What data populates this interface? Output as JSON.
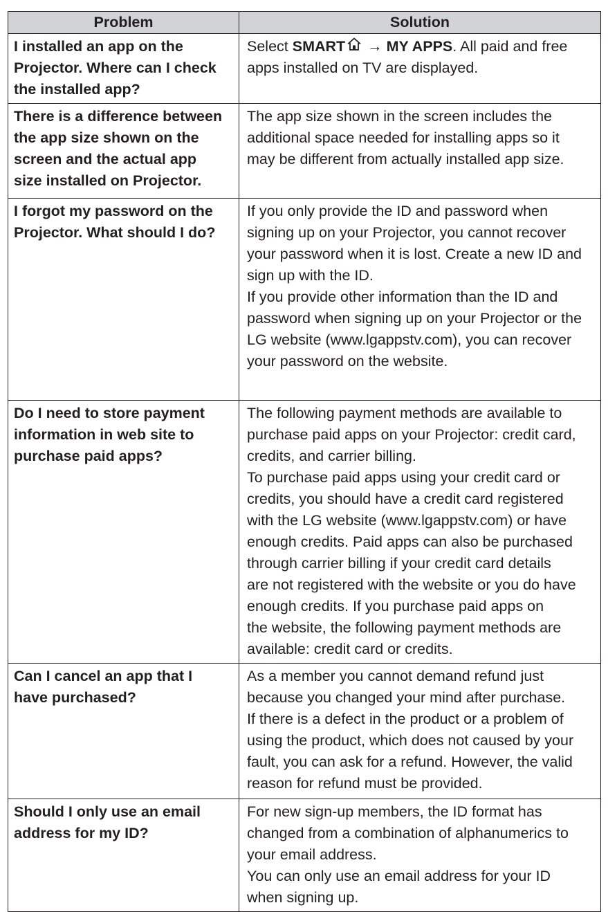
{
  "table": {
    "headers": {
      "problem": "Problem",
      "solution": "Solution"
    },
    "rows": [
      {
        "problem": [
          "I installed an app on the",
          "Projector. Where can I check",
          "the installed app?"
        ],
        "solution_intro": "Select ",
        "solution_smart": "SMART",
        "solution_arrow": " → ",
        "solution_myapps": "MY APPS",
        "solution_tail": ". All paid and free",
        "solution": [
          "apps installed on TV are displayed."
        ]
      },
      {
        "problem": [
          "There is a difference between",
          "the app size shown on the",
          "screen and the actual app",
          "size installed on Projector."
        ],
        "solution": [
          "The app size shown in the screen includes the",
          "additional space needed for installing apps so it",
          "may be different from actually installed app size."
        ]
      },
      {
        "problem": [
          "I forgot my password on the",
          "Projector. What should I do?"
        ],
        "solution": [
          "If you only provide the ID and password when",
          "signing up on your Projector, you cannot recover",
          "your password when it is lost. Create a new ID and",
          "sign up with the ID.",
          "If you provide other information than the ID and",
          "password when signing up on your Projector or the",
          "LG website (www.lgappstv.com), you can recover",
          "your password on the website."
        ]
      },
      {
        "problem": [
          "Do I need to store payment",
          "information in web site to",
          "purchase paid apps?"
        ],
        "solution": [
          "The following payment methods are available to",
          "purchase paid apps on your Projector: credit card,",
          "credits, and carrier billing.",
          "To purchase paid apps using your credit card or",
          "credits, you should have a credit card registered",
          "with the LG website (www.lgappstv.com) or have",
          "enough credits. Paid apps can also be purchased",
          "through carrier billing if your credit card details",
          "are not registered with the website or you do have",
          "enough credits. If you purchase paid apps on",
          "the website, the following payment methods are",
          "available: credit card or credits."
        ]
      },
      {
        "problem": [
          "Can I cancel an app that I",
          "have purchased?"
        ],
        "solution": [
          "As a member you cannot demand refund just",
          "because you changed your mind after purchase.",
          "If there is a defect in the product or a problem of",
          "using the product, which does not caused by your",
          "fault, you can ask for a refund. However, the valid",
          "reason for refund must be provided."
        ]
      },
      {
        "problem": [
          "Should I only use an email",
          "address for my ID?"
        ],
        "solution": [
          "For new sign-up members, the ID format has",
          "changed from a combination of alphanumerics to",
          "your email address.",
          "You can only use an email address for your ID",
          "when signing up."
        ]
      }
    ]
  },
  "icons": {
    "home": "home-icon"
  }
}
